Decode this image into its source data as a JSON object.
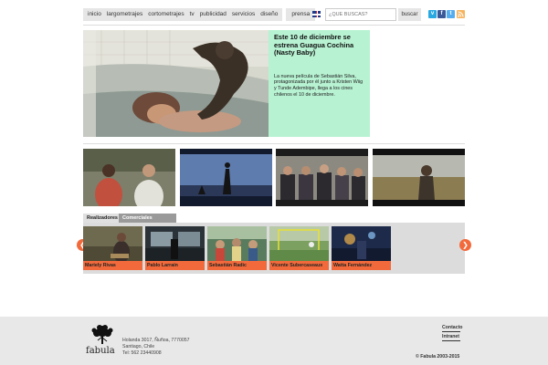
{
  "nav": {
    "items": [
      "inicio",
      "largometrajes",
      "cortometrajes",
      "tv",
      "publicidad",
      "servicios",
      "diseño"
    ],
    "press": "prensa"
  },
  "search": {
    "placeholder": "¿QUE BUSCAS?",
    "button": "buscar"
  },
  "social": [
    "vimeo-icon",
    "facebook-icon",
    "twitter-icon",
    "rss-icon"
  ],
  "hero": {
    "title": "Este 10 de diciembre se estrena Guagua Cochina (Nasty Baby)",
    "text": "La nueva película de Sebastián Silva, protagonizada por él junto a Kristen Wiig y Tunde Adembipe, llega a los cines chilenos el 10 de diciembre."
  },
  "tabs": [
    "Realizadores",
    "Comerciales Recientes"
  ],
  "directors": [
    "Mariely Rivas",
    "Pablo Larraín",
    "Sebastián Radic",
    "Vicente Subercaseaux",
    "Watta Fernández"
  ],
  "footer": {
    "logo": "fabula",
    "address": [
      "Holanda 3017, Ñuñoa, 7770057",
      "Santiago, Chile",
      "Tel: 562 23440908"
    ],
    "links": [
      "Contacto",
      "Intranet"
    ],
    "copyright": "© Fabula 2003-2015"
  },
  "colors": {
    "hero_panel": "#b7f2d2",
    "accent": "#f26a3c",
    "footer_bg": "#e8e8e8"
  }
}
